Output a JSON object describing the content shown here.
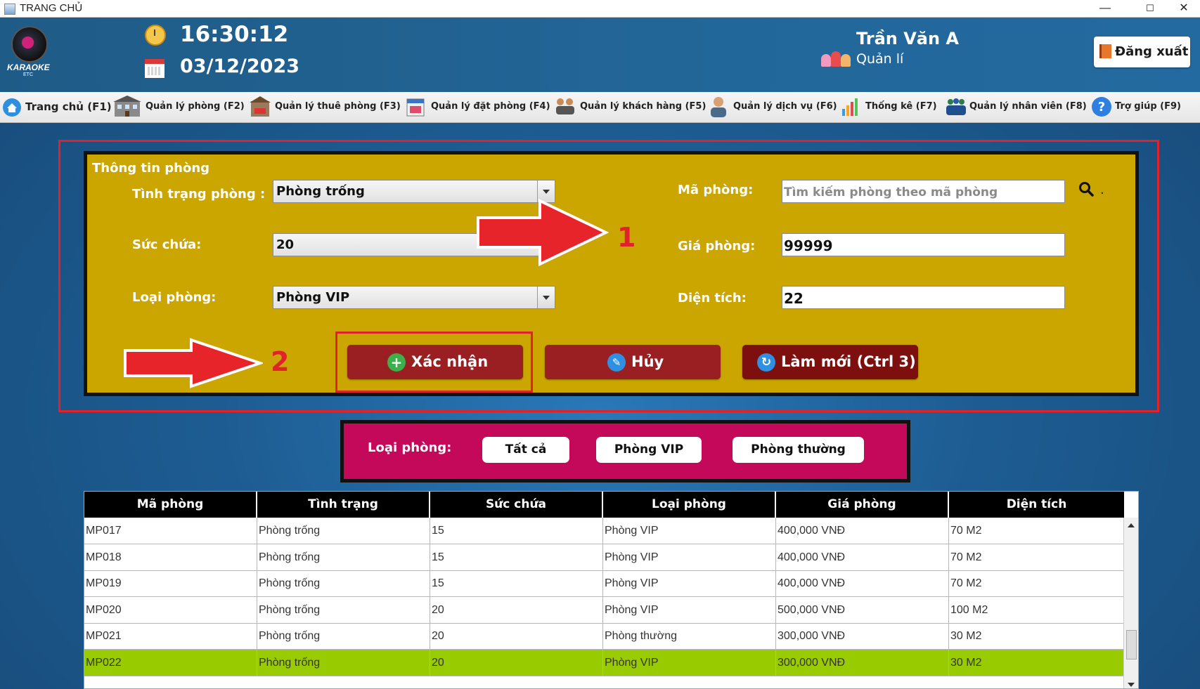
{
  "window": {
    "title": "TRANG CHỦ",
    "minimize": "—",
    "maximize": "☐",
    "close": "✕"
  },
  "header": {
    "logo_text": "KARAOKE",
    "logo_sub": "ETC",
    "time": "16:30:12",
    "date": "03/12/2023",
    "user_name": "Trần Văn A",
    "user_role": "Quản lí",
    "logout_label": "Đăng xuất"
  },
  "nav": [
    {
      "label": "Trang chủ (F1)",
      "icon": "home-icon"
    },
    {
      "label": "Quản lý phòng (F2)",
      "icon": "building-icon"
    },
    {
      "label": "Quản lý thuê phòng (F3)",
      "icon": "rent-icon"
    },
    {
      "label": "Quản lý đặt phòng (F4)",
      "icon": "booking-icon"
    },
    {
      "label": "Quản lý khách hàng (F5)",
      "icon": "customers-icon"
    },
    {
      "label": "Quản lý dịch vụ (F6)",
      "icon": "service-staff-icon"
    },
    {
      "label": "Thống kê (F7)",
      "icon": "bar-chart-icon"
    },
    {
      "label": "Quản lý nhân viên (F8)",
      "icon": "employees-icon"
    },
    {
      "label": "Trợ giúp (F9)",
      "icon": "help-icon"
    }
  ],
  "form": {
    "title": "Thông tin phòng",
    "status_label": "Tình trạng phòng :",
    "status_value": "Phòng trống",
    "capacity_label": "Sức chứa:",
    "capacity_value": "20",
    "type_label": "Loại phòng:",
    "type_value": "Phòng VIP",
    "code_label": "Mã phòng:",
    "code_placeholder": "Tìm kiếm phòng theo mã phòng",
    "search_dot": ".",
    "price_label": "Giá phòng:",
    "price_value": "99999",
    "area_label": "Diện tích:",
    "area_value": "22",
    "confirm_label": "Xác nhận",
    "cancel_label": "Hủy",
    "refresh_label": "Làm mới (Ctrl 3)"
  },
  "annotations": {
    "marker1": "1",
    "marker2": "2"
  },
  "filter": {
    "label": "Loại phòng:",
    "options": [
      "Tất cả",
      "Phòng VIP",
      "Phòng thường"
    ]
  },
  "table": {
    "columns": [
      "Mã phòng",
      "Tình trạng",
      "Sức chứa",
      "Loại phòng",
      "Giá phòng",
      "Diện tích"
    ],
    "rows": [
      [
        "MP017",
        "Phòng trống",
        "15",
        "Phòng VIP",
        "400,000 VNĐ",
        "70 M2"
      ],
      [
        "MP018",
        "Phòng trống",
        "15",
        "Phòng VIP",
        "400,000 VNĐ",
        "70 M2"
      ],
      [
        "MP019",
        "Phòng trống",
        "15",
        "Phòng VIP",
        "400,000 VNĐ",
        "70 M2"
      ],
      [
        "MP020",
        "Phòng trống",
        "20",
        "Phòng VIP",
        "500,000 VNĐ",
        "100 M2"
      ],
      [
        "MP021",
        "Phòng trống",
        "20",
        "Phòng thường",
        "300,000 VNĐ",
        "30 M2"
      ],
      [
        "MP022",
        "Phòng trống",
        "20",
        "Phòng VIP",
        "300,000 VNĐ",
        "30 M2"
      ]
    ],
    "selected_row": 5
  },
  "colors": {
    "panel": "#cba500",
    "filter_bar": "#c4085a",
    "action_button": "#9a1f22",
    "highlight_frame": "#e0232b",
    "selected_row": "#99cc00"
  }
}
